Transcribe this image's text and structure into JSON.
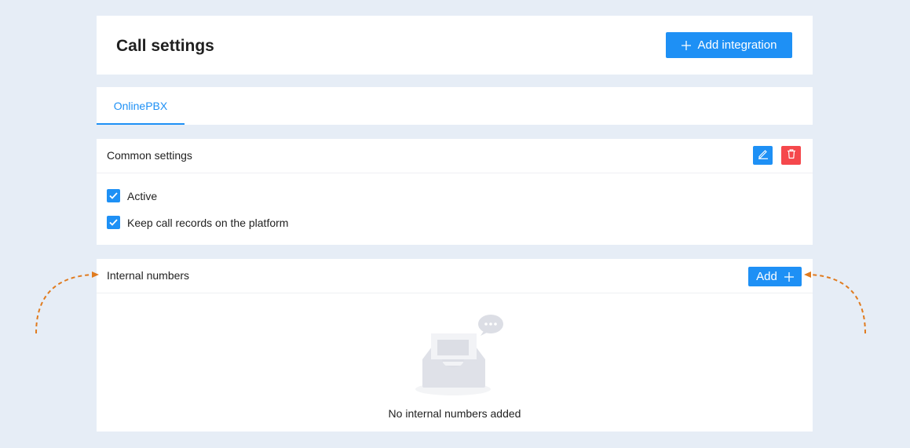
{
  "header": {
    "title": "Call settings",
    "add_integration_label": "Add integration"
  },
  "tabs": [
    {
      "label": "OnlinePBX",
      "active": true
    }
  ],
  "common_settings": {
    "title": "Common settings",
    "edit_icon": "pencil-icon",
    "delete_icon": "trash-icon",
    "options": [
      {
        "label": "Active",
        "checked": true
      },
      {
        "label": "Keep call records on the platform",
        "checked": true
      }
    ]
  },
  "internal_numbers": {
    "title": "Internal numbers",
    "add_label": "Add",
    "empty_text": "No internal numbers added"
  },
  "colors": {
    "primary": "#1e90f5",
    "danger": "#f5484c",
    "background": "#e6edf6",
    "annotation": "#e07b1f"
  }
}
